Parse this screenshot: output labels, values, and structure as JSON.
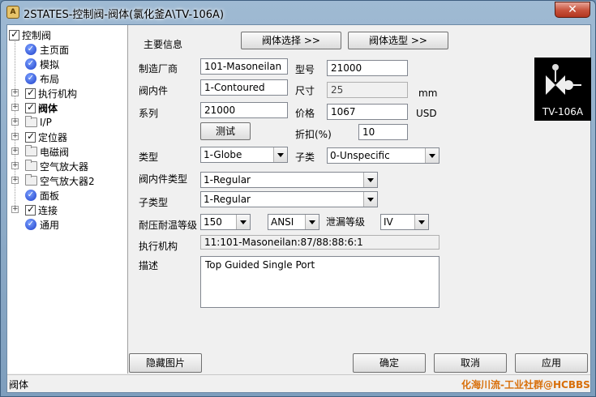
{
  "window": {
    "title": "2STATES-控制阀-阀体(氯化釜A\\TV-106A)",
    "app_icon": "A",
    "close": "✕"
  },
  "tree": {
    "root": "控制阀",
    "items": [
      {
        "label": "主页面",
        "type": "badge"
      },
      {
        "label": "模拟",
        "type": "badge"
      },
      {
        "label": "布局",
        "type": "badge"
      },
      {
        "label": "执行机构",
        "type": "check"
      },
      {
        "label": "阀体",
        "type": "check"
      },
      {
        "label": "I/P",
        "type": "folder"
      },
      {
        "label": "定位器",
        "type": "check"
      },
      {
        "label": "电磁阀",
        "type": "folder"
      },
      {
        "label": "空气放大器",
        "type": "folder"
      },
      {
        "label": "空气放大器2",
        "type": "folder"
      },
      {
        "label": "面板",
        "type": "badge"
      },
      {
        "label": "连接",
        "type": "check"
      },
      {
        "label": "通用",
        "type": "badge"
      }
    ]
  },
  "form": {
    "main_info": "主要信息",
    "select_valve": "阀体选择 >>",
    "valve_sizing": "阀体选型 >>",
    "manufacturer_label": "制造厂商",
    "manufacturer_value": "101-Masoneilan",
    "model_label": "型号",
    "model_value": "21000",
    "trim_label": "阀内件",
    "trim_value": "1-Contoured",
    "size_label": "尺寸",
    "size_value": "25",
    "size_unit": "mm",
    "series_label": "系列",
    "series_value": "21000",
    "price_label": "价格",
    "price_value": "1067",
    "price_unit": "USD",
    "test_button": "测试",
    "discount_label": "折扣(%)",
    "discount_value": "10",
    "type_label": "类型",
    "type_value": "1-Globe",
    "subclass_label": "子类",
    "subclass_value": "0-Unspecific",
    "trim_type_label": "阀内件类型",
    "trim_type_value": "1-Regular",
    "subtype_label": "子类型",
    "subtype_value": "1-Regular",
    "pt_rating_label": "耐压耐温等级",
    "pt_rating_value": "150",
    "standard_value": "ANSI",
    "leakage_label": "泄漏等级",
    "leakage_value": "IV",
    "actuator_label": "执行机构",
    "actuator_value": "11:101-Masoneilan:87/88:88:6:1",
    "description_label": "描述",
    "description_value": "Top Guided Single Port",
    "tag_caption": "TV-106A"
  },
  "buttons": {
    "hide_image": "隐藏图片",
    "ok": "确定",
    "cancel": "取消",
    "apply": "应用"
  },
  "status": {
    "text": "阀体",
    "watermark": "化海川流-工业社群@HCBBS"
  }
}
